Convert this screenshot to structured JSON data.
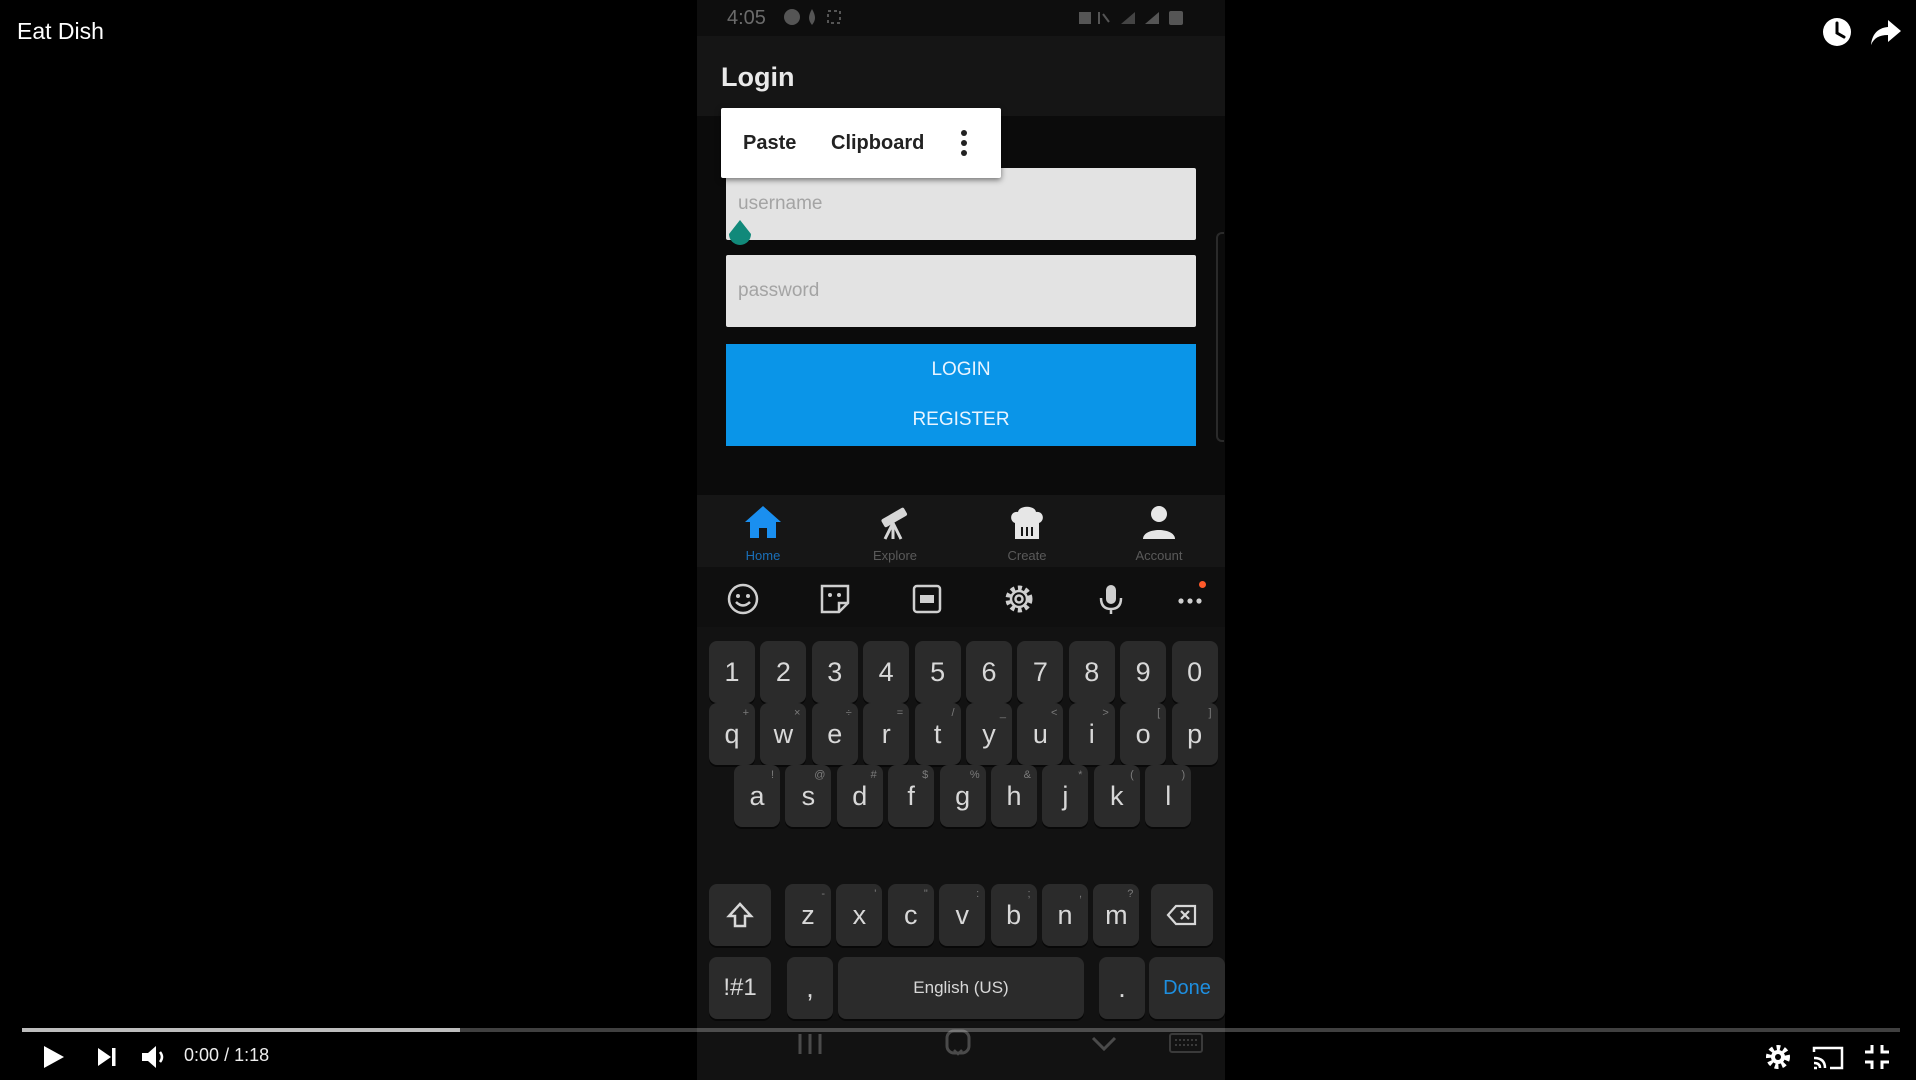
{
  "player": {
    "title": "Eat Dish",
    "time_current": "0:00",
    "time_separator": "/",
    "time_total": "1:18",
    "progress_fraction": 0.233
  },
  "phone": {
    "status_time": "4:05",
    "app_title": "Login",
    "context_menu": {
      "paste": "Paste",
      "clipboard": "Clipboard"
    },
    "username_placeholder": "username",
    "password_placeholder": "password",
    "login_label": "LOGIN",
    "register_label": "REGISTER",
    "nav": [
      {
        "label": "Home",
        "icon": "home-icon",
        "active": true
      },
      {
        "label": "Explore",
        "icon": "telescope-icon"
      },
      {
        "label": "Create",
        "icon": "chef-hat-icon"
      },
      {
        "label": "Account",
        "icon": "person-icon"
      }
    ],
    "keyboard": {
      "row_numbers": [
        "1",
        "2",
        "3",
        "4",
        "5",
        "6",
        "7",
        "8",
        "9",
        "0"
      ],
      "row1": [
        "q",
        "w",
        "e",
        "r",
        "t",
        "y",
        "u",
        "i",
        "o",
        "p"
      ],
      "row1_sub": [
        "+",
        "×",
        "÷",
        "=",
        "/",
        "_",
        "<",
        ">",
        "[",
        "]"
      ],
      "row2": [
        "a",
        "s",
        "d",
        "f",
        "g",
        "h",
        "j",
        "k",
        "l"
      ],
      "row2_sub": [
        "!",
        "@",
        "#",
        "$",
        "%",
        "&",
        "*",
        "(",
        ")"
      ],
      "row3": [
        "z",
        "x",
        "c",
        "v",
        "b",
        "n",
        "m"
      ],
      "row3_sub": [
        "-",
        "'",
        "\"",
        ":",
        ";",
        ",",
        "?"
      ],
      "symbols_label": "!#1",
      "comma": ",",
      "space_label": "English (US)",
      "period": ".",
      "done_label": "Done"
    }
  },
  "colors": {
    "accent": "#0a95e8",
    "handle": "#11897a",
    "active_nav": "#1a8ff0"
  }
}
